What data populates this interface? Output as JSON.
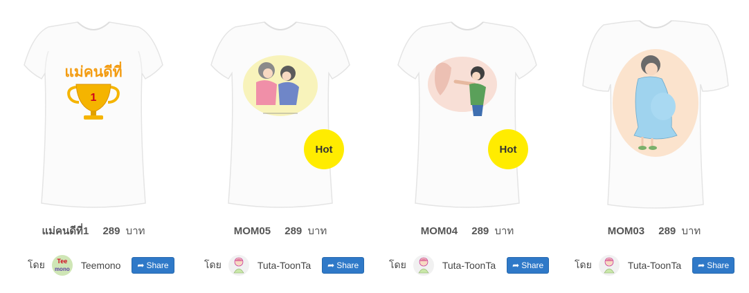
{
  "products": [
    {
      "name": "แม่คนดีที่1",
      "price": "289",
      "unit": "บาท",
      "by_label": "โดย",
      "seller": "Teemono",
      "share_label": "Share",
      "hot": false,
      "print_text": "แม่คนดีที่",
      "trophy_number": "1",
      "avatar_text_top": "Tee",
      "avatar_text_bottom": "mono"
    },
    {
      "name": "MOM05",
      "price": "289",
      "unit": "บาท",
      "by_label": "โดย",
      "seller": "Tuta-ToonTa",
      "share_label": "Share",
      "hot": true,
      "hot_label": "Hot"
    },
    {
      "name": "MOM04",
      "price": "289",
      "unit": "บาท",
      "by_label": "โดย",
      "seller": "Tuta-ToonTa",
      "share_label": "Share",
      "hot": true,
      "hot_label": "Hot"
    },
    {
      "name": "MOM03",
      "price": "289",
      "unit": "บาท",
      "by_label": "โดย",
      "seller": "Tuta-ToonTa",
      "share_label": "Share",
      "hot": false
    }
  ],
  "colors": {
    "accent_hot": "#ffec00",
    "share_button": "#2f79c8",
    "trophy": "#f5b400",
    "print_text": "#f39c12"
  },
  "icons": {
    "share": "share-arrow-icon",
    "hot": "hot-badge"
  }
}
